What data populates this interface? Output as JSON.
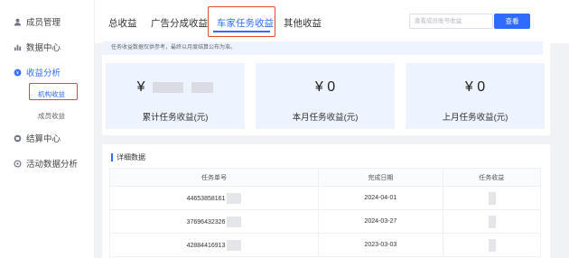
{
  "sidebar": {
    "items": [
      {
        "label": "成员管理",
        "icon": "user-icon"
      },
      {
        "label": "数据中心",
        "icon": "bar-chart-icon"
      },
      {
        "label": "收益分析",
        "icon": "coin-icon"
      },
      {
        "label": "结算中心",
        "icon": "wallet-icon"
      },
      {
        "label": "活动数据分析",
        "icon": "activity-icon"
      }
    ],
    "sub_items": [
      {
        "label": "机构收益"
      },
      {
        "label": "成员收益"
      }
    ]
  },
  "tabs": [
    {
      "label": "总收益"
    },
    {
      "label": "广告分成收益"
    },
    {
      "label": "车家任务收益"
    },
    {
      "label": "其他收益"
    }
  ],
  "search": {
    "placeholder": "查看成员账号收益",
    "button_label": "查看"
  },
  "notice": "任务收益数据仅供参考，最终以月度结算公布为准。",
  "cards": [
    {
      "amount": "¥",
      "label": "累计任务收益(元)"
    },
    {
      "amount": "¥ 0",
      "label": "本月任务收益(元)"
    },
    {
      "amount": "¥ 0",
      "label": "上月任务收益(元)"
    }
  ],
  "detail": {
    "title": "详细数据",
    "columns": [
      "任务单号",
      "完成日期",
      "任务收益"
    ],
    "rows": [
      {
        "order_no": "44653858161",
        "date": "2024-04-01"
      },
      {
        "order_no": "37696432326",
        "date": "2024-03-27"
      },
      {
        "order_no": "42884416913",
        "date": "2023-03-03"
      }
    ]
  },
  "colors": {
    "accent": "#2f6bff",
    "highlight_box": "#e0482f",
    "card_bg": "#eef4ff"
  }
}
